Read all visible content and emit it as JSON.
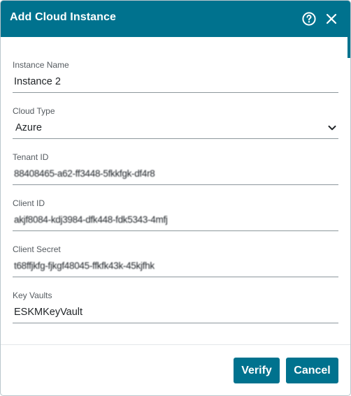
{
  "dialog": {
    "title": "Add Cloud Instance",
    "help_icon": "question-circle-icon",
    "close_icon": "close-icon"
  },
  "form": {
    "instance_name": {
      "label": "Instance Name",
      "value": "Instance 2"
    },
    "cloud_type": {
      "label": "Cloud Type",
      "value": "Azure",
      "icon": "chevron-down-icon"
    },
    "tenant_id": {
      "label": "Tenant ID",
      "value": "88408465-a62-ff3448-5fkkfgk-df4r8"
    },
    "client_id": {
      "label": "Client ID",
      "value": "akjf8084-kdj3984-dfk448-fdk5343-4mfj"
    },
    "client_secret": {
      "label": "Client Secret",
      "value": "t68ffjkfg-fjkgf48045-ffkfk43k-45kjfhk"
    },
    "key_vaults": {
      "label": "Key Vaults",
      "value": "ESKMKeyVault"
    }
  },
  "footer": {
    "verify_label": "Verify",
    "cancel_label": "Cancel"
  },
  "colors": {
    "accent": "#00728e",
    "field_line": "#8d979c",
    "label_text": "#555b60"
  }
}
